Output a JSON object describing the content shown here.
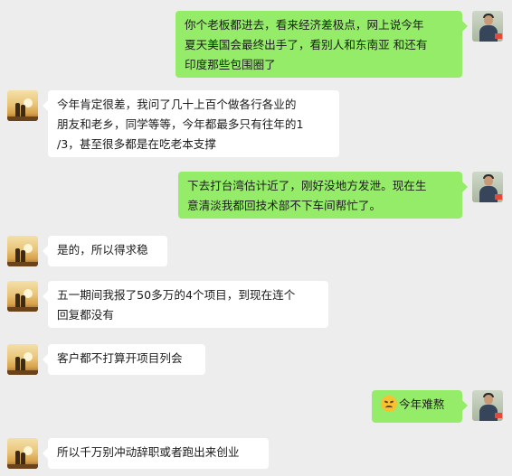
{
  "messages": [
    {
      "side": "right",
      "avatar": "man-photo-avatar",
      "lines": [
        "你个老板都进去，看来经济差极点，网上说今年",
        "夏天美国会最终出手了，看别人和东南亚 和还有",
        "印度那些包围圈了"
      ]
    },
    {
      "side": "left",
      "avatar": "sunset-couple-avatar",
      "lines": [
        "今年肯定很差，我问了几十上百个做各行各业的",
        "朋友和老乡，同学等等，今年都最多只有往年的1",
        "/3，甚至很多都是在吃老本支撑"
      ]
    },
    {
      "side": "right",
      "avatar": "man-photo-avatar",
      "lines": [
        "下去打台湾估计近了，刚好没地方发泄。现在生",
        "意清淡我都回技术部不下车间帮忙了。"
      ]
    },
    {
      "side": "left",
      "avatar": "sunset-couple-avatar",
      "lines": [
        "是的，所以得求稳"
      ]
    },
    {
      "side": "left",
      "avatar": "sunset-couple-avatar",
      "lines": [
        "五一期间我报了50多万的4个项目，到现在连个",
        "回复都没有"
      ]
    },
    {
      "side": "left",
      "avatar": "sunset-couple-avatar",
      "lines": [
        "客户都不打算开项目列会"
      ]
    },
    {
      "side": "right",
      "avatar": "man-photo-avatar",
      "emoji": "frowning-face-emoji",
      "lines": [
        "今年难熬"
      ]
    },
    {
      "side": "left",
      "avatar": "sunset-couple-avatar",
      "lines": [
        "所以千万别冲动辞职或者跑出来创业"
      ]
    }
  ]
}
